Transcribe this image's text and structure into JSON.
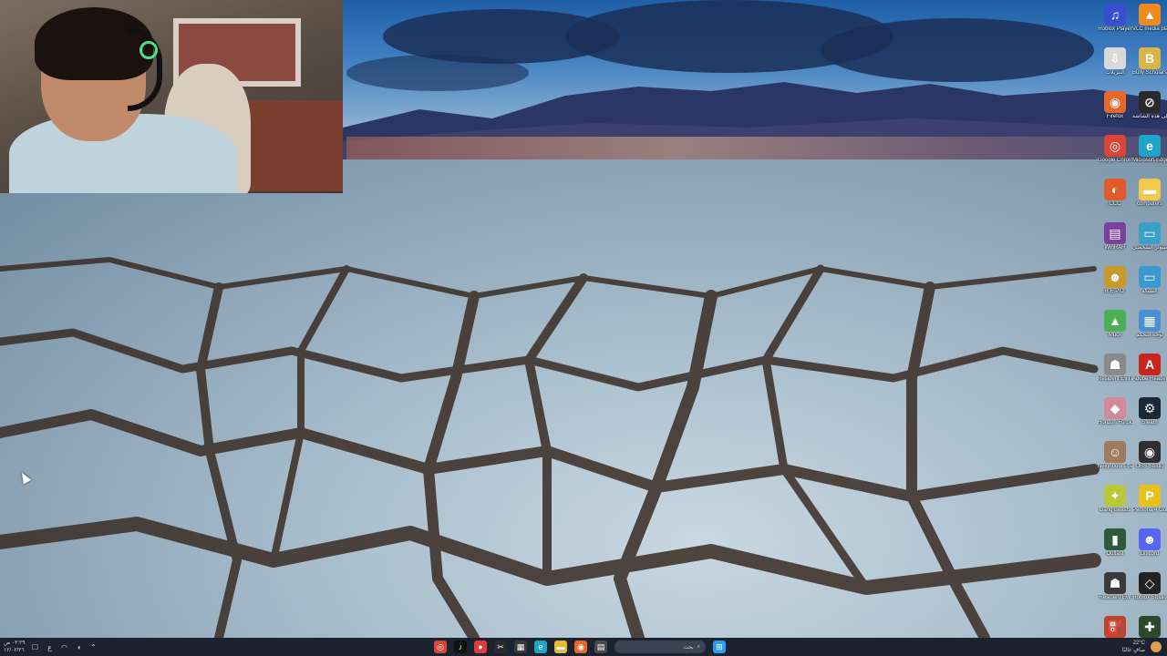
{
  "desktop": {
    "icons": [
      {
        "label": "Roblox Player",
        "icon": "roblox-player-icon",
        "color": "#3a4fd0",
        "glyph": "♫"
      },
      {
        "label": "VLC media player",
        "icon": "vlc-icon",
        "color": "#f08a1c",
        "glyph": "▲"
      },
      {
        "label": "التنزيلات",
        "icon": "downloads-folder-icon",
        "color": "#d9d9d9",
        "glyph": "⇩"
      },
      {
        "label": "Bully Scholarsh...",
        "icon": "bully-game-icon",
        "color": "#d9b44a",
        "glyph": "B"
      },
      {
        "label": "Firefox",
        "icon": "firefox-icon",
        "color": "#e8672b",
        "glyph": "◉"
      },
      {
        "label": "ترسل إلى هذه الشاشة",
        "icon": "screen-share-icon",
        "color": "#2a2a2a",
        "glyph": "⊘"
      },
      {
        "label": "Google Chrome",
        "icon": "chrome-icon",
        "color": "#db4437",
        "glyph": "◎"
      },
      {
        "label": "Microsoft Edge",
        "icon": "edge-icon",
        "color": "#1fa3c8",
        "glyph": "e"
      },
      {
        "label": "CCC",
        "icon": "ccc-icon",
        "color": "#e05a2a",
        "glyph": "◐"
      },
      {
        "label": "computers",
        "icon": "folder-icon",
        "color": "#f2c94c",
        "glyph": "▬"
      },
      {
        "label": "WinRAR",
        "icon": "winrar-icon",
        "color": "#7a3fa0",
        "glyph": "▤"
      },
      {
        "label": "هذا الكمبيوتر الشخصي",
        "icon": "this-pc-icon",
        "color": "#3aa0c8",
        "glyph": "▭"
      },
      {
        "label": "R.E.P.O.",
        "icon": "repo-game-icon",
        "color": "#c89a2a",
        "glyph": "☻"
      },
      {
        "label": "الشبكة",
        "icon": "network-icon",
        "color": "#3a9ad0",
        "glyph": "▭"
      },
      {
        "label": "Muck",
        "icon": "muck-game-icon",
        "color": "#4caf50",
        "glyph": "▲"
      },
      {
        "label": "لوحة التحكم",
        "icon": "control-panel-icon",
        "color": "#4a8fd0",
        "glyph": "▦"
      },
      {
        "label": "Resident Evil Requiem",
        "icon": "re-requiem-icon",
        "color": "#8a8a8a",
        "glyph": "☗"
      },
      {
        "label": "Adobe Reader X",
        "icon": "adobe-reader-icon",
        "color": "#c8261c",
        "glyph": "A"
      },
      {
        "label": "Horizon Forbidde...",
        "icon": "horizon-game-icon",
        "color": "#d08a9a",
        "glyph": "◆"
      },
      {
        "label": "Steam",
        "icon": "steam-icon",
        "color": "#1b2838",
        "glyph": "⚙"
      },
      {
        "label": "Neighbours back From...",
        "icon": "neighbours-game-icon",
        "color": "#a07a5a",
        "glyph": "☺"
      },
      {
        "label": "OBS Studio",
        "icon": "obs-icon",
        "color": "#302e31",
        "glyph": "◉"
      },
      {
        "label": "Gang Beasts",
        "icon": "gang-beasts-icon",
        "color": "#b8c83a",
        "glyph": "✦"
      },
      {
        "label": "Persona 4 Golden",
        "icon": "persona4-icon",
        "color": "#e8c21a",
        "glyph": "P"
      },
      {
        "label": "Outlast",
        "icon": "outlast-icon",
        "color": "#2f5a3a",
        "glyph": "▮"
      },
      {
        "label": "Discord",
        "icon": "discord-icon",
        "color": "#5865f2",
        "glyph": "☻"
      },
      {
        "label": "Resident Evil",
        "icon": "resident-evil-icon",
        "color": "#3a3a3a",
        "glyph": "☗"
      },
      {
        "label": "Roblox Studio",
        "icon": "roblox-studio-icon",
        "color": "#222222",
        "glyph": "◇"
      },
      {
        "label": "Gas Station Simulator",
        "icon": "gas-station-icon",
        "color": "#c0442a",
        "glyph": "⛽"
      },
      {
        "label": "Outlast 2",
        "icon": "outlast2-icon",
        "color": "#2a4a2a",
        "glyph": "✚"
      }
    ]
  },
  "taskbar": {
    "time": "٠٣:٢٩ ص",
    "date": "١٢/٠٢/٢٦",
    "lang": "ع",
    "search_placeholder": "بحث",
    "weather_temp": "22°C",
    "weather_desc": "صافٍ غالبًا",
    "apps": [
      {
        "icon": "chrome-taskbar-icon",
        "color": "#db4437",
        "glyph": "◎"
      },
      {
        "icon": "tiktok-taskbar-icon",
        "color": "#111111",
        "glyph": "♪"
      },
      {
        "icon": "recorder-taskbar-icon",
        "color": "#e03a3a",
        "glyph": "●"
      },
      {
        "icon": "capcut-taskbar-icon",
        "color": "#2a2a2a",
        "glyph": "✂"
      },
      {
        "icon": "calendar-taskbar-icon",
        "color": "#3a3a3a",
        "glyph": "▦"
      },
      {
        "icon": "edge-taskbar-icon",
        "color": "#1fa3c8",
        "glyph": "e"
      },
      {
        "icon": "explorer-taskbar-icon",
        "color": "#e8b830",
        "glyph": "▬"
      },
      {
        "icon": "firefox-taskbar-icon",
        "color": "#e8672b",
        "glyph": "◉"
      },
      {
        "icon": "notes-taskbar-icon",
        "color": "#4a4a4a",
        "glyph": "▤"
      }
    ],
    "start_color": "#2a9df4"
  }
}
